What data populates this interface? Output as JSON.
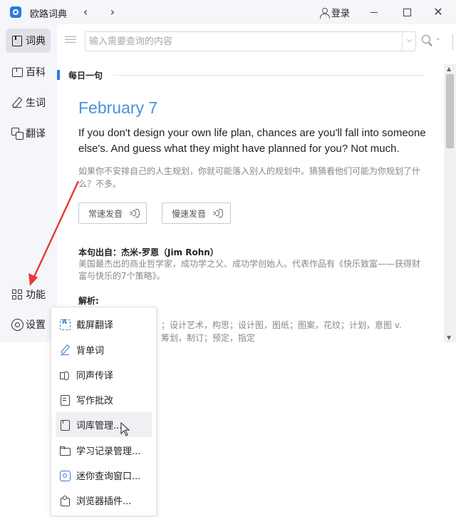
{
  "app": {
    "title": "欧路词典",
    "login_label": "登录"
  },
  "sidebar": {
    "items": [
      {
        "label": "词典",
        "icon": "book-icon",
        "active": true
      },
      {
        "label": "百科",
        "icon": "wiki-icon"
      },
      {
        "label": "生词",
        "icon": "pen-icon"
      },
      {
        "label": "翻译",
        "icon": "translate-icon"
      }
    ],
    "bottom_items": [
      {
        "label": "功能",
        "icon": "grid-icon"
      },
      {
        "label": "设置",
        "icon": "gear-icon"
      }
    ]
  },
  "search": {
    "value": "",
    "placeholder": "输入需要查询的内容"
  },
  "daily": {
    "section_title": "每日一句",
    "date": "February 7",
    "sentence_en": "If you don't design your own life plan, chances are you'll fall into someone else's. And guess what they might have planned for you? Not much.",
    "sentence_cn": "如果你不安排自己的人生规划，你就可能落入别人的规划中。猜猜看他们可能为你规划了什么？不多。",
    "speak_normal_label": "常速发音",
    "speak_slow_label": "慢速发音",
    "source_label": "本句出自：杰米-罗恩（Jim Rohn）",
    "source_desc": "美国最杰出的商业哲学家，成功学之父、成功学创始人。代表作品有《快乐致富——获得财富与快乐的7个策略》。",
    "analysis_label": "解析:",
    "analysis_text_line1": "；设计艺术，构思；设计图，图纸；图案，花纹；计划，意图 v.",
    "analysis_text_line2": "筹划，制订；预定，指定"
  },
  "menu": {
    "items": [
      {
        "label": "截屏翻译",
        "icon": "screenshot-translate-icon"
      },
      {
        "label": "背单词",
        "icon": "pencil-icon"
      },
      {
        "label": "同声传译",
        "icon": "speaker-icon"
      },
      {
        "label": "写作批改",
        "icon": "document-icon"
      },
      {
        "label": "词库管理...",
        "icon": "book-icon",
        "hover": true
      },
      {
        "label": "学习记录管理...",
        "icon": "folder-icon"
      },
      {
        "label": "迷你查询窗口...",
        "icon": "mini-window-icon"
      },
      {
        "label": "浏览器插件...",
        "icon": "puzzle-icon"
      }
    ]
  },
  "colors": {
    "accent": "#2a7ae2",
    "date": "#4a8fde",
    "annotation_arrow": "#e53935"
  }
}
